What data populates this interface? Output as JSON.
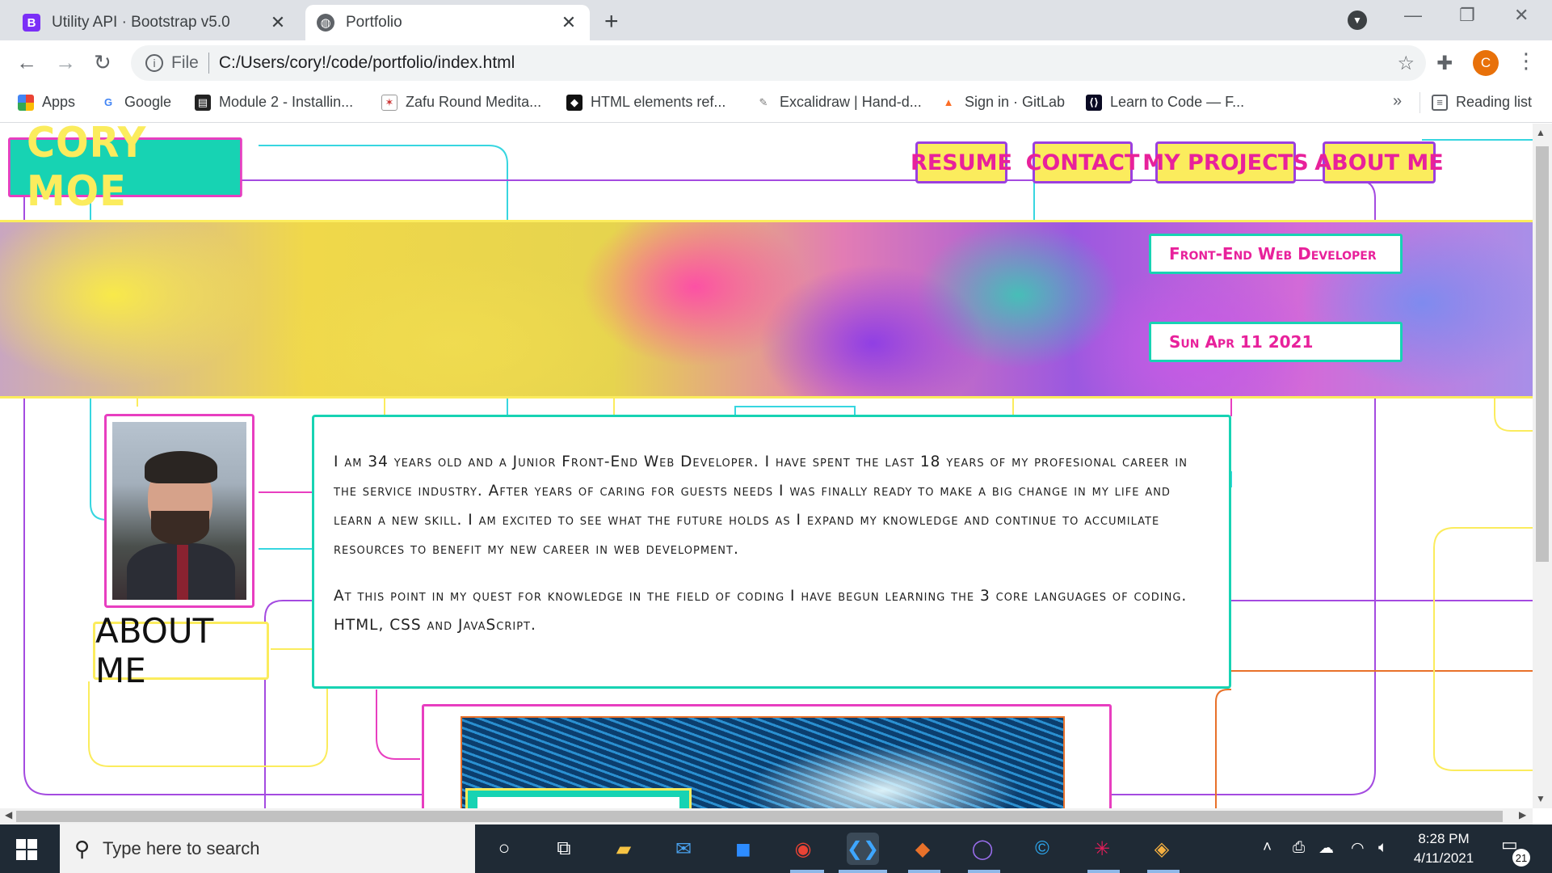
{
  "browser": {
    "tabs": [
      {
        "title": "Utility API · Bootstrap v5.0",
        "favicon": "B",
        "favicon_color": "#7b2ff7",
        "active": false
      },
      {
        "title": "Portfolio",
        "favicon": "globe-icon",
        "active": true
      }
    ],
    "address": {
      "scheme_label": "File",
      "url": "C:/Users/cory!/code/portfolio/index.html"
    },
    "profile_initial": "C",
    "bookmarks": [
      {
        "label": "Apps",
        "icon": "apps-grid-icon"
      },
      {
        "label": "Google",
        "icon": "google-icon"
      },
      {
        "label": "Module 2 - Installin...",
        "icon": "book-icon"
      },
      {
        "label": "Zafu Round Medita...",
        "icon": "zafu-icon"
      },
      {
        "label": "HTML elements ref...",
        "icon": "mdn-icon"
      },
      {
        "label": "Excalidraw | Hand-d...",
        "icon": "excalidraw-icon"
      },
      {
        "label": "Sign in · GitLab",
        "icon": "gitlab-icon"
      },
      {
        "label": "Learn to Code — F...",
        "icon": "freecodecamp-icon"
      }
    ],
    "more_bookmarks": "»",
    "reading_list": "Reading list"
  },
  "page": {
    "brand": "CORY MOE",
    "nav": [
      "RESUME",
      "CONTACT",
      "MY PROJECTS",
      "ABOUT ME"
    ],
    "hero": {
      "title_tag": "Front-End Web Developer",
      "date_tag": "Sun Apr 11 2021"
    },
    "about": {
      "heading": "ABOUT ME",
      "paragraphs": [
        "I am 34 years old and a Junior Front-End Web Developer. I have spent the last 18 years of my profesional career in the service industry. After years of caring for guests needs I was finally ready to make a big change in my life and learn a new skill. I am excited to see what the future holds as I expand my knowledge and continue to accumilate resources to benefit my new career in web development.",
        "At this point in my quest for knowledge in the field of coding I have begun learning the 3 core languages of coding. HTML, CSS and JavaScript."
      ]
    },
    "colors": {
      "teal": "#17d3b3",
      "yellow": "#fbec5d",
      "magenta": "#e83ec0",
      "purple": "#9b3fe0",
      "pink_text": "#e8219b"
    }
  },
  "taskbar": {
    "search_placeholder": "Type here to search",
    "apps": [
      "cortana-icon",
      "task-view-icon",
      "file-explorer-icon",
      "mail-icon",
      "zoom-icon",
      "chrome-icon",
      "vscode-icon",
      "git-icon",
      "obs-icon",
      "c-app-icon",
      "slack-icon",
      "sourcetree-icon"
    ],
    "time": "8:28 PM",
    "date": "4/11/2021",
    "notifications": "21"
  }
}
